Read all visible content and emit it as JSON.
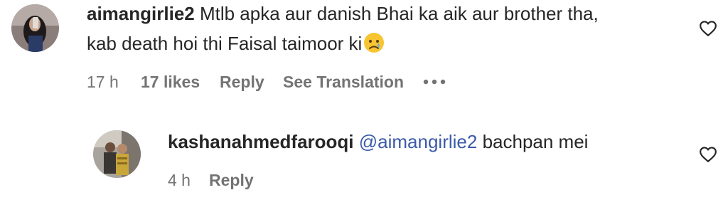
{
  "comments": [
    {
      "username": "aimangirlie2",
      "text_line1": "Mtlb apka aur danish Bhai ka aik aur brother tha,",
      "text_line2": "kab death hoi thi Faisal taimoor ki",
      "emoji": "crying-face",
      "time": "17 h",
      "likes": "17 likes",
      "reply_label": "Reply",
      "translation_label": "See Translation"
    },
    {
      "username": "kashanahmedfarooqi",
      "mention": "@aimangirlie2",
      "text": "bachpan mei",
      "time": "4 h",
      "reply_label": "Reply"
    }
  ],
  "colors": {
    "text": "#262626",
    "meta": "#737373",
    "mention": "#3b5aa8"
  },
  "icons": [
    "heart-outline-icon",
    "more-options-icon",
    "crying-face-emoji"
  ]
}
